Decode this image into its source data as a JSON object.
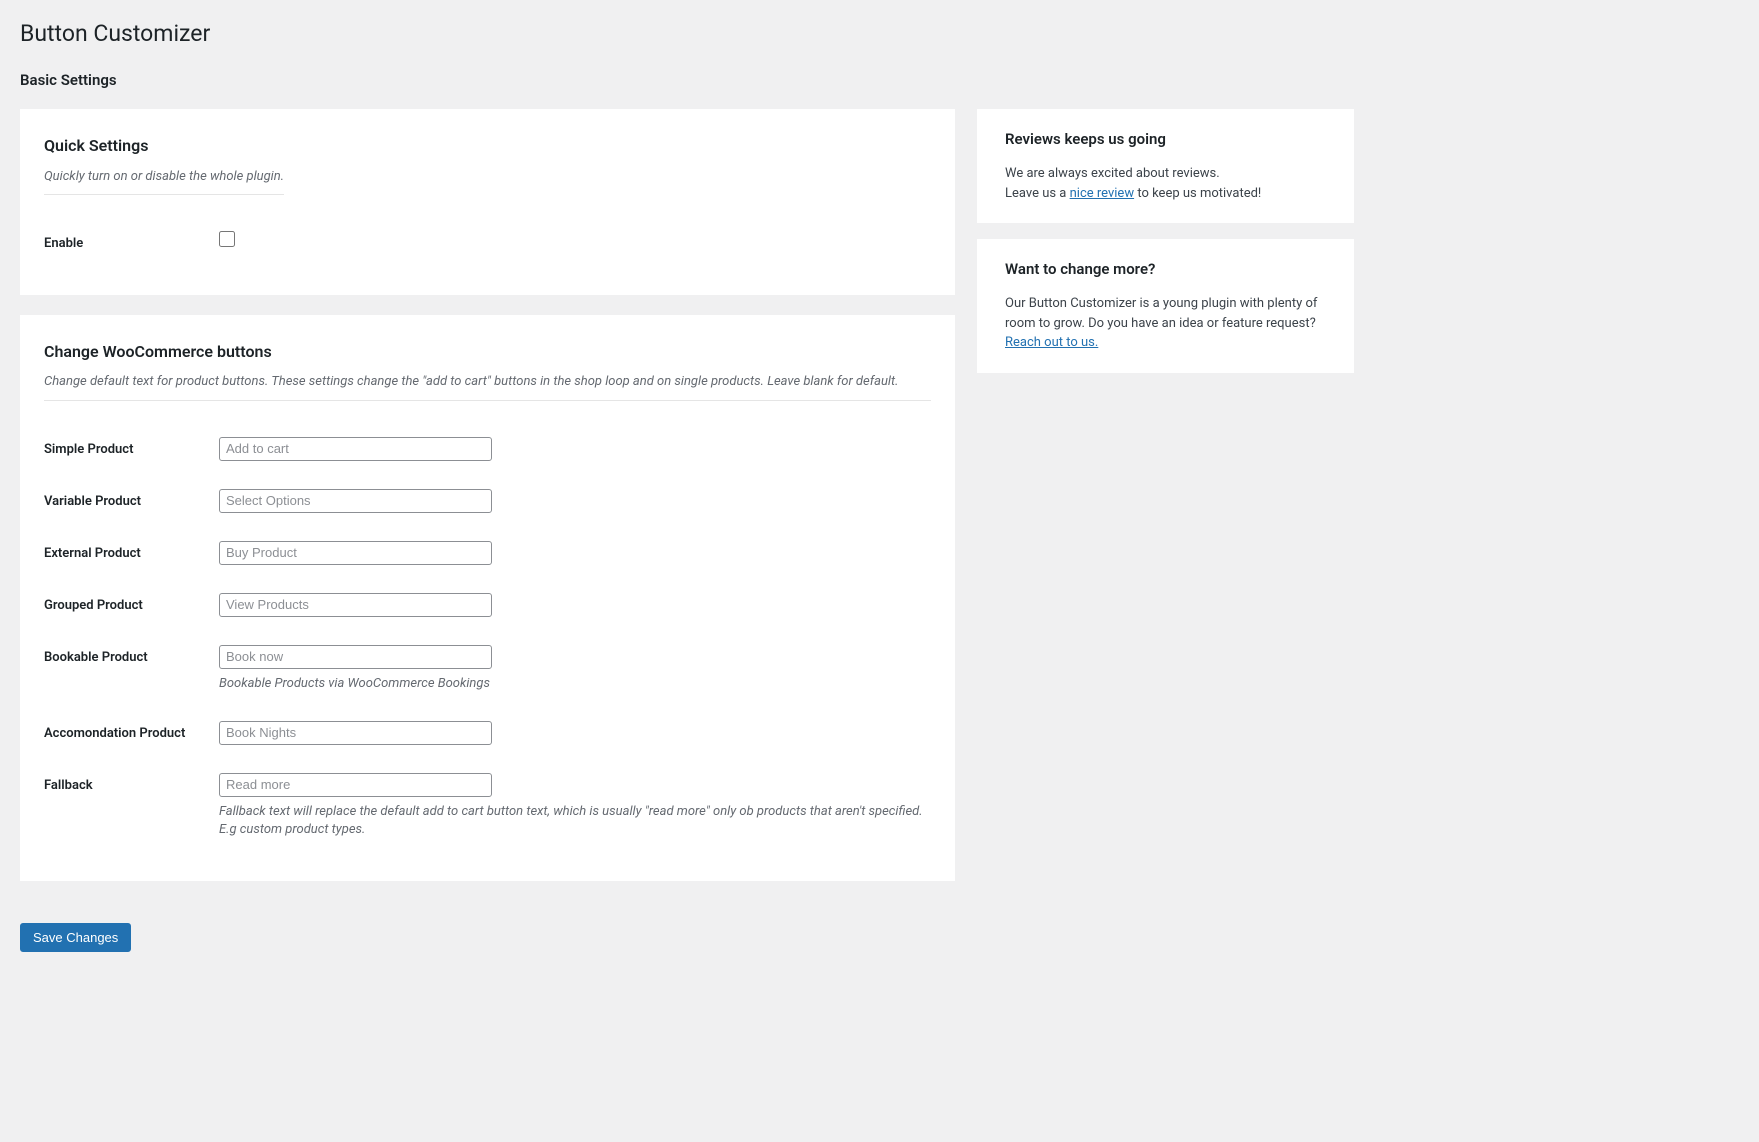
{
  "page_title": "Button Customizer",
  "section_heading": "Basic Settings",
  "quick_settings": {
    "title": "Quick Settings",
    "subtitle": "Quickly turn on or disable the whole plugin.",
    "enable_label": "Enable"
  },
  "woo_buttons": {
    "title": "Change WooCommerce buttons",
    "subtitle": "Change default text for product buttons. These settings change the \"add to cart\" buttons in the shop loop and on single products. Leave blank for default.",
    "fields": {
      "simple": {
        "label": "Simple Product",
        "placeholder": "Add to cart",
        "value": ""
      },
      "variable": {
        "label": "Variable Product",
        "placeholder": "Select Options",
        "value": ""
      },
      "external": {
        "label": "External Product",
        "placeholder": "Buy Product",
        "value": ""
      },
      "grouped": {
        "label": "Grouped Product",
        "placeholder": "View Products",
        "value": ""
      },
      "bookable": {
        "label": "Bookable Product",
        "placeholder": "Book now",
        "value": "",
        "help": "Bookable Products via WooCommerce Bookings"
      },
      "accommodation": {
        "label": "Accomondation Product",
        "placeholder": "Book Nights",
        "value": ""
      },
      "fallback": {
        "label": "Fallback",
        "placeholder": "Read more",
        "value": "",
        "help": "Fallback text will replace the default add to cart button text, which is usually \"read more\" only ob products that aren't specified. E.g custom product types."
      }
    }
  },
  "save_button": "Save Changes",
  "sidebar": {
    "reviews": {
      "title": "Reviews keeps us going",
      "line1": "We are always excited about reviews.",
      "line2_prefix": "Leave us a ",
      "link_text": "nice review",
      "line2_suffix": " to keep us motivated!"
    },
    "change_more": {
      "title": "Want to change more?",
      "text": "Our Button Customizer is a young plugin with plenty of room to grow. Do you have an idea or feature request? ",
      "link_text": "Reach out to us."
    }
  }
}
